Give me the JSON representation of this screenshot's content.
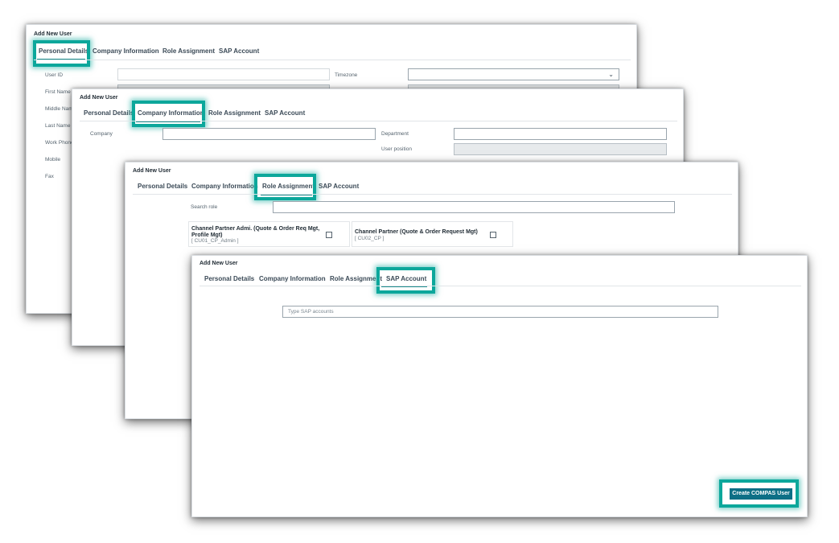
{
  "common": {
    "title": "Add New User",
    "tabs": [
      "Personal Details",
      "Company Information",
      "Role Assignment",
      "SAP Account"
    ]
  },
  "personal": {
    "fields_left": [
      "User ID",
      "First Name",
      "Middle Name",
      "Last Name",
      "Work Phone",
      "Mobile",
      "Fax"
    ],
    "timezone_label": "Timezone"
  },
  "company": {
    "company_label": "Company",
    "department_label": "Department",
    "position_label": "User position"
  },
  "roles": {
    "search_label": "Search role",
    "items": [
      {
        "name_line1": "Channel Partner Admi. (Quote & Order Req Mgt,",
        "name_line2": "Profile Mgt)",
        "code": "[ CU01_CP_Admin ]"
      },
      {
        "name_line1": "Channel Partner (Quote & Order Request Mgt)",
        "name_line2": "",
        "code": "[ CU02_CP ]"
      }
    ]
  },
  "sap": {
    "search_placeholder": "Type SAP accounts",
    "create_button": "Create COMPAS User"
  },
  "colors": {
    "highlight": "#0ca79b",
    "primary_button": "#0d6f86"
  }
}
